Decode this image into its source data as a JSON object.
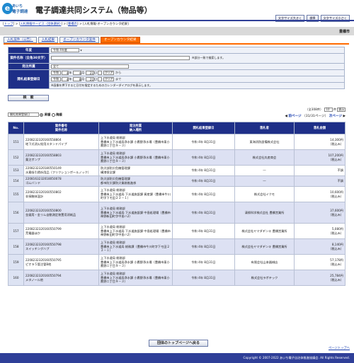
{
  "header": {
    "logo_top": "あいち",
    "logo_bottom": "電子調達",
    "title": "電子調達共同システム（物品等）",
    "buttons": [
      "文字サイズ大きく",
      "標準",
      "文字サイズ小さく"
    ]
  },
  "breadcrumb": {
    "items": [
      "トップ",
      "入札情報サービス（団体選択）",
      "豊橋市",
      "入札情報-オープンカウンタ結果"
    ],
    "sep": " > "
  },
  "municipality": "豊橋市",
  "tabs": [
    "入札案件（公告）",
    "入札結果",
    "オープンカウンタ案件",
    "オープンカウンタ結果"
  ],
  "search": {
    "year_label": "年度",
    "year_value": "令和 4年度",
    "name_label": "案件名称（全角30文字）",
    "name_note": "※部分一致で検索します。",
    "dept_label": "発注所属",
    "dept_value": "全て",
    "date_label": "開札結果登録日",
    "from_year": "令和",
    "from_y": "4",
    "from_m": "4",
    "from_d": "21",
    "to_year": "令和",
    "to_y": "4",
    "to_m": "8",
    "to_d": "21",
    "unit_y": "年",
    "unit_m": "月",
    "unit_d": "日",
    "clear": "クリア",
    "from_suffix": "から",
    "to_suffix": "まで",
    "date_note": "※画像を押下すると日付を指定するためのカレンダーダイアログを表示します。",
    "button": "検　索"
  },
  "sort": {
    "select": "開札結果登録日",
    "asc": "昇順",
    "desc": "降順"
  },
  "pager": {
    "info": "（全308件）",
    "per_page": "10",
    "per_unit": "件",
    "show": "表示",
    "prev": "前ページ",
    "pos": "（31/31ページ）",
    "next": "次ページ"
  },
  "table": {
    "headers": [
      "No.",
      "案件番号\n案件名称",
      "発注所属\n納入場所",
      "開札結果登録日",
      "落札者",
      "落札金額"
    ],
    "rows": [
      {
        "no": "151",
        "num": "2208232320160558804",
        "name": "地下式消火栓用スタンドパイプ",
        "dept": "上下水道局 総務部",
        "place": "豊橋市上下水道局浄水課 小鷹野浄水場（豊橋市東小鷹野二丁目９－３）",
        "date": "令和 4年 8月31日",
        "winner": "東海消防設備株式会社",
        "amount": "14,300円",
        "tax": "（税込み）"
      },
      {
        "no": "152",
        "num": "2208232320160558803",
        "name": "薬注ポンプ",
        "dept": "上下水道局 総務部",
        "place": "豊橋市上下水道局浄水課 小鷹野浄水場（豊橋市東小鷹野二丁目９－３）",
        "date": "令和 4年 8月31日",
        "winner": "株式会社丸産商会",
        "amount": "107,200円",
        "tax": "（税込み）"
      },
      {
        "no": "153",
        "num": "2208232320180550149",
        "name": "水素吸引透析用品（フリクションボールノック）",
        "dept": "防災部防災危機管理課",
        "place": "構港保全課",
        "date": "令和 4年 8月31日",
        "winner": "―",
        "amount": "不調",
        "tax": ""
      },
      {
        "no": "154",
        "num": "2208163232018050078",
        "name": "ゴムバンド",
        "dept": "防災部防災危機管理課",
        "place": "都市防災課防災業務推進係",
        "date": "令和 4年 8月31日",
        "winner": "―",
        "amount": "不調",
        "tax": ""
      },
      {
        "no": "155",
        "num": "2208232320160550802",
        "name": "非接触体温計",
        "dept": "上下水道局 総務部",
        "place": "豊橋市上下水道局 下水道施設課 資産課（豊橋市牛川町字下モ田２３－１）",
        "date": "令和 4年 8月31日",
        "winner": "株式会社イクモ",
        "amount": "10,600円",
        "tax": "（税込み）"
      },
      {
        "no": "156",
        "num": "2208232320160550800",
        "name": "金鋸用・金リム自動測定装置用消耗品",
        "dept": "上下水道局 総務部",
        "place": "豊橋市上下水道局 下水道施設課 中島処理場（豊橋市神野新田町字中島ハ2）",
        "date": "令和 4年 8月31日",
        "winner": "清掃科学株式会社 豊橋営業所",
        "amount": "37,600円",
        "tax": "（税込み）"
      },
      {
        "no": "157",
        "num": "2208232320160550799",
        "name": "荒電器ほか",
        "dept": "上下水道局 総務部",
        "place": "豊橋市上下水道局 下水道施設課 中島処理場（豊橋市神野新田町字中島ハ2）",
        "date": "令和 4年 8月31日",
        "winner": "株式会社ヤマダデンキ 豊橋営業所",
        "amount": "5,080円",
        "tax": "（税込み）"
      },
      {
        "no": "158",
        "num": "2208232320160550798",
        "name": "スイッチングハブ",
        "dept": "上下水道局 総務部",
        "place": "豊橋市上下水道局 総務課（豊橋市牛川町字下モ田２３－１）",
        "date": "令和 4年 8月31日",
        "winner": "株式会社ヤマダデンキ 豊橋営業所",
        "amount": "8,140円",
        "tax": "（税込み）"
      },
      {
        "no": "159",
        "num": "2208232320160550795",
        "name": "ピオラ５管注管B他",
        "dept": "上下水道局 総務部",
        "place": "豊橋市上下水道局浄水課 小鷹野浄水場（豊橋市東小鷹野二丁目９－３）",
        "date": "令和 4年 8月31日",
        "winner": "有限会社山本器械店",
        "amount": "57,178円",
        "tax": "（税込み）"
      },
      {
        "no": "160",
        "num": "2208232320160550794",
        "name": "メタノール他",
        "dept": "上下水道局 総務部",
        "place": "豊橋市上下水道局浄水課 小鷹野浄水場（豊橋市東小鷹野二丁目９－３）",
        "date": "令和 4年 8月31日",
        "winner": "株式会社ラボテック",
        "amount": "25,784円",
        "tax": "（税込み）"
      }
    ]
  },
  "back_button": "団体のトップページへ戻る",
  "to_top": "ページトップへ",
  "footer": "Copyright © 2007-2022 あいち電子自治体推進協議会. All Rights Reserved."
}
